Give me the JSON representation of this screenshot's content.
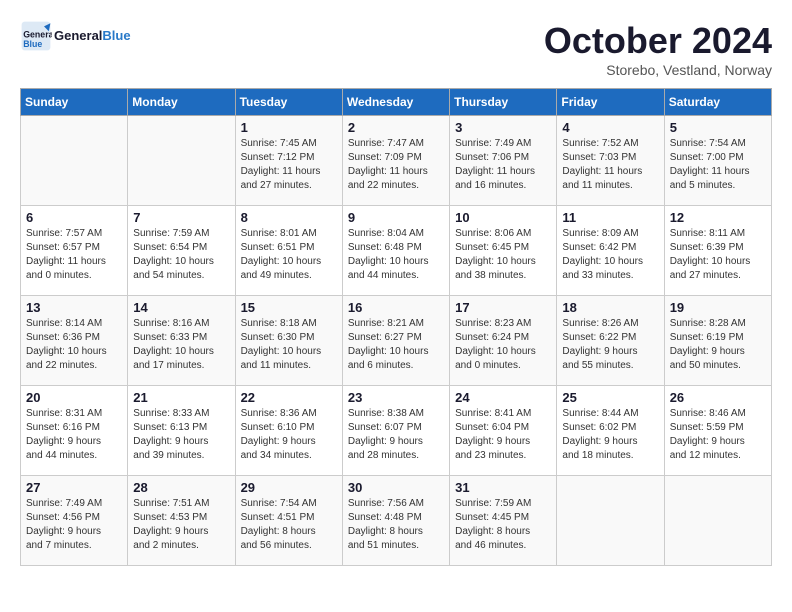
{
  "logo": {
    "text_general": "General",
    "text_blue": "Blue"
  },
  "title": "October 2024",
  "subtitle": "Storebo, Vestland, Norway",
  "days_header": [
    "Sunday",
    "Monday",
    "Tuesday",
    "Wednesday",
    "Thursday",
    "Friday",
    "Saturday"
  ],
  "weeks": [
    [
      {
        "day": "",
        "info": ""
      },
      {
        "day": "",
        "info": ""
      },
      {
        "day": "1",
        "info": "Sunrise: 7:45 AM\nSunset: 7:12 PM\nDaylight: 11 hours\nand 27 minutes."
      },
      {
        "day": "2",
        "info": "Sunrise: 7:47 AM\nSunset: 7:09 PM\nDaylight: 11 hours\nand 22 minutes."
      },
      {
        "day": "3",
        "info": "Sunrise: 7:49 AM\nSunset: 7:06 PM\nDaylight: 11 hours\nand 16 minutes."
      },
      {
        "day": "4",
        "info": "Sunrise: 7:52 AM\nSunset: 7:03 PM\nDaylight: 11 hours\nand 11 minutes."
      },
      {
        "day": "5",
        "info": "Sunrise: 7:54 AM\nSunset: 7:00 PM\nDaylight: 11 hours\nand 5 minutes."
      }
    ],
    [
      {
        "day": "6",
        "info": "Sunrise: 7:57 AM\nSunset: 6:57 PM\nDaylight: 11 hours\nand 0 minutes."
      },
      {
        "day": "7",
        "info": "Sunrise: 7:59 AM\nSunset: 6:54 PM\nDaylight: 10 hours\nand 54 minutes."
      },
      {
        "day": "8",
        "info": "Sunrise: 8:01 AM\nSunset: 6:51 PM\nDaylight: 10 hours\nand 49 minutes."
      },
      {
        "day": "9",
        "info": "Sunrise: 8:04 AM\nSunset: 6:48 PM\nDaylight: 10 hours\nand 44 minutes."
      },
      {
        "day": "10",
        "info": "Sunrise: 8:06 AM\nSunset: 6:45 PM\nDaylight: 10 hours\nand 38 minutes."
      },
      {
        "day": "11",
        "info": "Sunrise: 8:09 AM\nSunset: 6:42 PM\nDaylight: 10 hours\nand 33 minutes."
      },
      {
        "day": "12",
        "info": "Sunrise: 8:11 AM\nSunset: 6:39 PM\nDaylight: 10 hours\nand 27 minutes."
      }
    ],
    [
      {
        "day": "13",
        "info": "Sunrise: 8:14 AM\nSunset: 6:36 PM\nDaylight: 10 hours\nand 22 minutes."
      },
      {
        "day": "14",
        "info": "Sunrise: 8:16 AM\nSunset: 6:33 PM\nDaylight: 10 hours\nand 17 minutes."
      },
      {
        "day": "15",
        "info": "Sunrise: 8:18 AM\nSunset: 6:30 PM\nDaylight: 10 hours\nand 11 minutes."
      },
      {
        "day": "16",
        "info": "Sunrise: 8:21 AM\nSunset: 6:27 PM\nDaylight: 10 hours\nand 6 minutes."
      },
      {
        "day": "17",
        "info": "Sunrise: 8:23 AM\nSunset: 6:24 PM\nDaylight: 10 hours\nand 0 minutes."
      },
      {
        "day": "18",
        "info": "Sunrise: 8:26 AM\nSunset: 6:22 PM\nDaylight: 9 hours\nand 55 minutes."
      },
      {
        "day": "19",
        "info": "Sunrise: 8:28 AM\nSunset: 6:19 PM\nDaylight: 9 hours\nand 50 minutes."
      }
    ],
    [
      {
        "day": "20",
        "info": "Sunrise: 8:31 AM\nSunset: 6:16 PM\nDaylight: 9 hours\nand 44 minutes."
      },
      {
        "day": "21",
        "info": "Sunrise: 8:33 AM\nSunset: 6:13 PM\nDaylight: 9 hours\nand 39 minutes."
      },
      {
        "day": "22",
        "info": "Sunrise: 8:36 AM\nSunset: 6:10 PM\nDaylight: 9 hours\nand 34 minutes."
      },
      {
        "day": "23",
        "info": "Sunrise: 8:38 AM\nSunset: 6:07 PM\nDaylight: 9 hours\nand 28 minutes."
      },
      {
        "day": "24",
        "info": "Sunrise: 8:41 AM\nSunset: 6:04 PM\nDaylight: 9 hours\nand 23 minutes."
      },
      {
        "day": "25",
        "info": "Sunrise: 8:44 AM\nSunset: 6:02 PM\nDaylight: 9 hours\nand 18 minutes."
      },
      {
        "day": "26",
        "info": "Sunrise: 8:46 AM\nSunset: 5:59 PM\nDaylight: 9 hours\nand 12 minutes."
      }
    ],
    [
      {
        "day": "27",
        "info": "Sunrise: 7:49 AM\nSunset: 4:56 PM\nDaylight: 9 hours\nand 7 minutes."
      },
      {
        "day": "28",
        "info": "Sunrise: 7:51 AM\nSunset: 4:53 PM\nDaylight: 9 hours\nand 2 minutes."
      },
      {
        "day": "29",
        "info": "Sunrise: 7:54 AM\nSunset: 4:51 PM\nDaylight: 8 hours\nand 56 minutes."
      },
      {
        "day": "30",
        "info": "Sunrise: 7:56 AM\nSunset: 4:48 PM\nDaylight: 8 hours\nand 51 minutes."
      },
      {
        "day": "31",
        "info": "Sunrise: 7:59 AM\nSunset: 4:45 PM\nDaylight: 8 hours\nand 46 minutes."
      },
      {
        "day": "",
        "info": ""
      },
      {
        "day": "",
        "info": ""
      }
    ]
  ]
}
